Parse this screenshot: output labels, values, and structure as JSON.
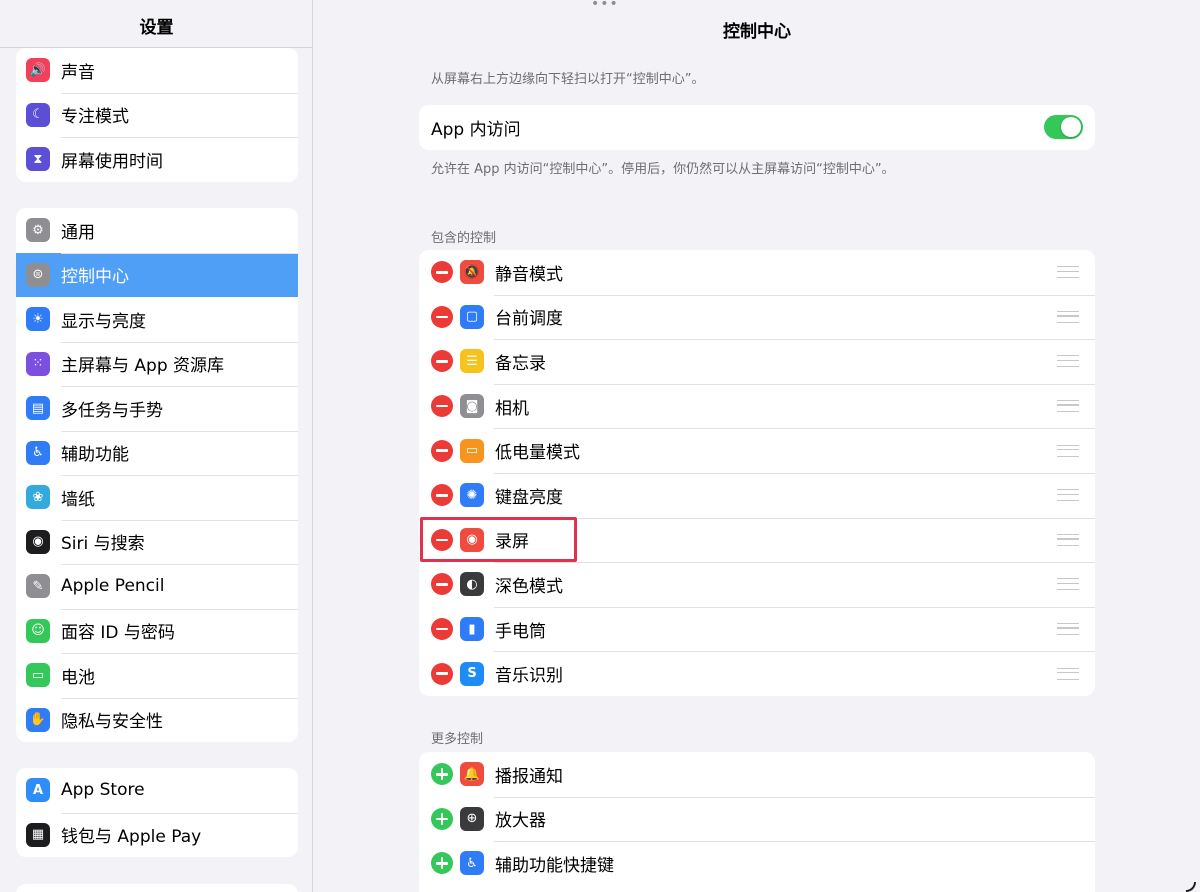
{
  "sidebar": {
    "title": "设置",
    "group1": [
      {
        "label": "声音",
        "icon": "speaker-icon",
        "color": "#f2405b",
        "glyph": "🔊"
      },
      {
        "label": "专注模式",
        "icon": "moon-icon",
        "color": "#5b4fd6",
        "glyph": "☾"
      },
      {
        "label": "屏幕使用时间",
        "icon": "hourglass-icon",
        "color": "#5b4fd6",
        "glyph": "⧗"
      }
    ],
    "group2": [
      {
        "label": "通用",
        "icon": "gear-icon",
        "color": "#8e8e93",
        "glyph": "⚙"
      },
      {
        "label": "控制中心",
        "icon": "switches-icon",
        "color": "#8e8e93",
        "glyph": "⊜",
        "selected": true
      },
      {
        "label": "显示与亮度",
        "icon": "sun-icon",
        "color": "#2f7cf6",
        "glyph": "☀"
      },
      {
        "label": "主屏幕与 App 资源库",
        "icon": "app-grid-icon",
        "color": "#7b4fe0",
        "glyph": "⁙"
      },
      {
        "label": "多任务与手势",
        "icon": "multitask-icon",
        "color": "#2f7cf6",
        "glyph": "▤"
      },
      {
        "label": "辅助功能",
        "icon": "accessibility-icon",
        "color": "#2f7cf6",
        "glyph": "♿"
      },
      {
        "label": "墙纸",
        "icon": "flower-icon",
        "color": "#34aadc",
        "glyph": "❀"
      },
      {
        "label": "Siri 与搜索",
        "icon": "siri-icon",
        "color": "#1c1c1e",
        "glyph": "◉"
      },
      {
        "label": "Apple Pencil",
        "icon": "pencil-icon",
        "color": "#8e8e93",
        "glyph": "✎"
      },
      {
        "label": "面容 ID 与密码",
        "icon": "faceid-icon",
        "color": "#34c759",
        "glyph": "☺"
      },
      {
        "label": "电池",
        "icon": "battery-icon",
        "color": "#34c759",
        "glyph": "▭"
      },
      {
        "label": "隐私与安全性",
        "icon": "hand-icon",
        "color": "#2f7cf6",
        "glyph": "✋"
      }
    ],
    "group3": [
      {
        "label": "App Store",
        "icon": "appstore-icon",
        "color": "#2f8ef6",
        "glyph": "A"
      },
      {
        "label": "钱包与 Apple Pay",
        "icon": "wallet-icon",
        "color": "#1c1c1e",
        "glyph": "▦"
      }
    ]
  },
  "main": {
    "title": "控制中心",
    "top_hint": "从屏幕右上方边缘向下轻扫以打开“控制中心”。",
    "app_access": {
      "label": "App 内访问",
      "on": true
    },
    "app_access_hint": "允许在 App 内访问“控制中心”。停用后，你仍然可以从主屏幕访问“控制中心”。",
    "included_header": "包含的控制",
    "included": [
      {
        "label": "静音模式",
        "icon": "bell-slash-icon",
        "color": "#ef4b3f",
        "glyph": "🔕"
      },
      {
        "label": "台前调度",
        "icon": "stage-manager-icon",
        "color": "#2f7cf6",
        "glyph": "▢"
      },
      {
        "label": "备忘录",
        "icon": "notes-icon",
        "color": "#f7c21b",
        "glyph": "☰"
      },
      {
        "label": "相机",
        "icon": "camera-icon",
        "color": "#8e8e93",
        "glyph": "◙"
      },
      {
        "label": "低电量模式",
        "icon": "low-battery-icon",
        "color": "#f7941d",
        "glyph": "▭"
      },
      {
        "label": "键盘亮度",
        "icon": "keyboard-brightness-icon",
        "color": "#2f7cf6",
        "glyph": "✺"
      },
      {
        "label": "录屏",
        "icon": "screen-record-icon",
        "color": "#ef4b3f",
        "glyph": "◉"
      },
      {
        "label": "深色模式",
        "icon": "dark-mode-icon",
        "color": "#3a3a3c",
        "glyph": "◐"
      },
      {
        "label": "手电筒",
        "icon": "flashlight-icon",
        "color": "#2f7cf6",
        "glyph": "▮"
      },
      {
        "label": "音乐识别",
        "icon": "shazam-icon",
        "color": "#1d8cf6",
        "glyph": "S"
      }
    ],
    "more_header": "更多控制",
    "more": [
      {
        "label": "播报通知",
        "icon": "announce-notifications-icon",
        "color": "#ef4b3f",
        "glyph": "🔔"
      },
      {
        "label": "放大器",
        "icon": "magnifier-icon",
        "color": "#3a3a3c",
        "glyph": "⊕"
      },
      {
        "label": "辅助功能快捷键",
        "icon": "accessibility-shortcut-icon",
        "color": "#2f7cf6",
        "glyph": "♿"
      }
    ]
  }
}
